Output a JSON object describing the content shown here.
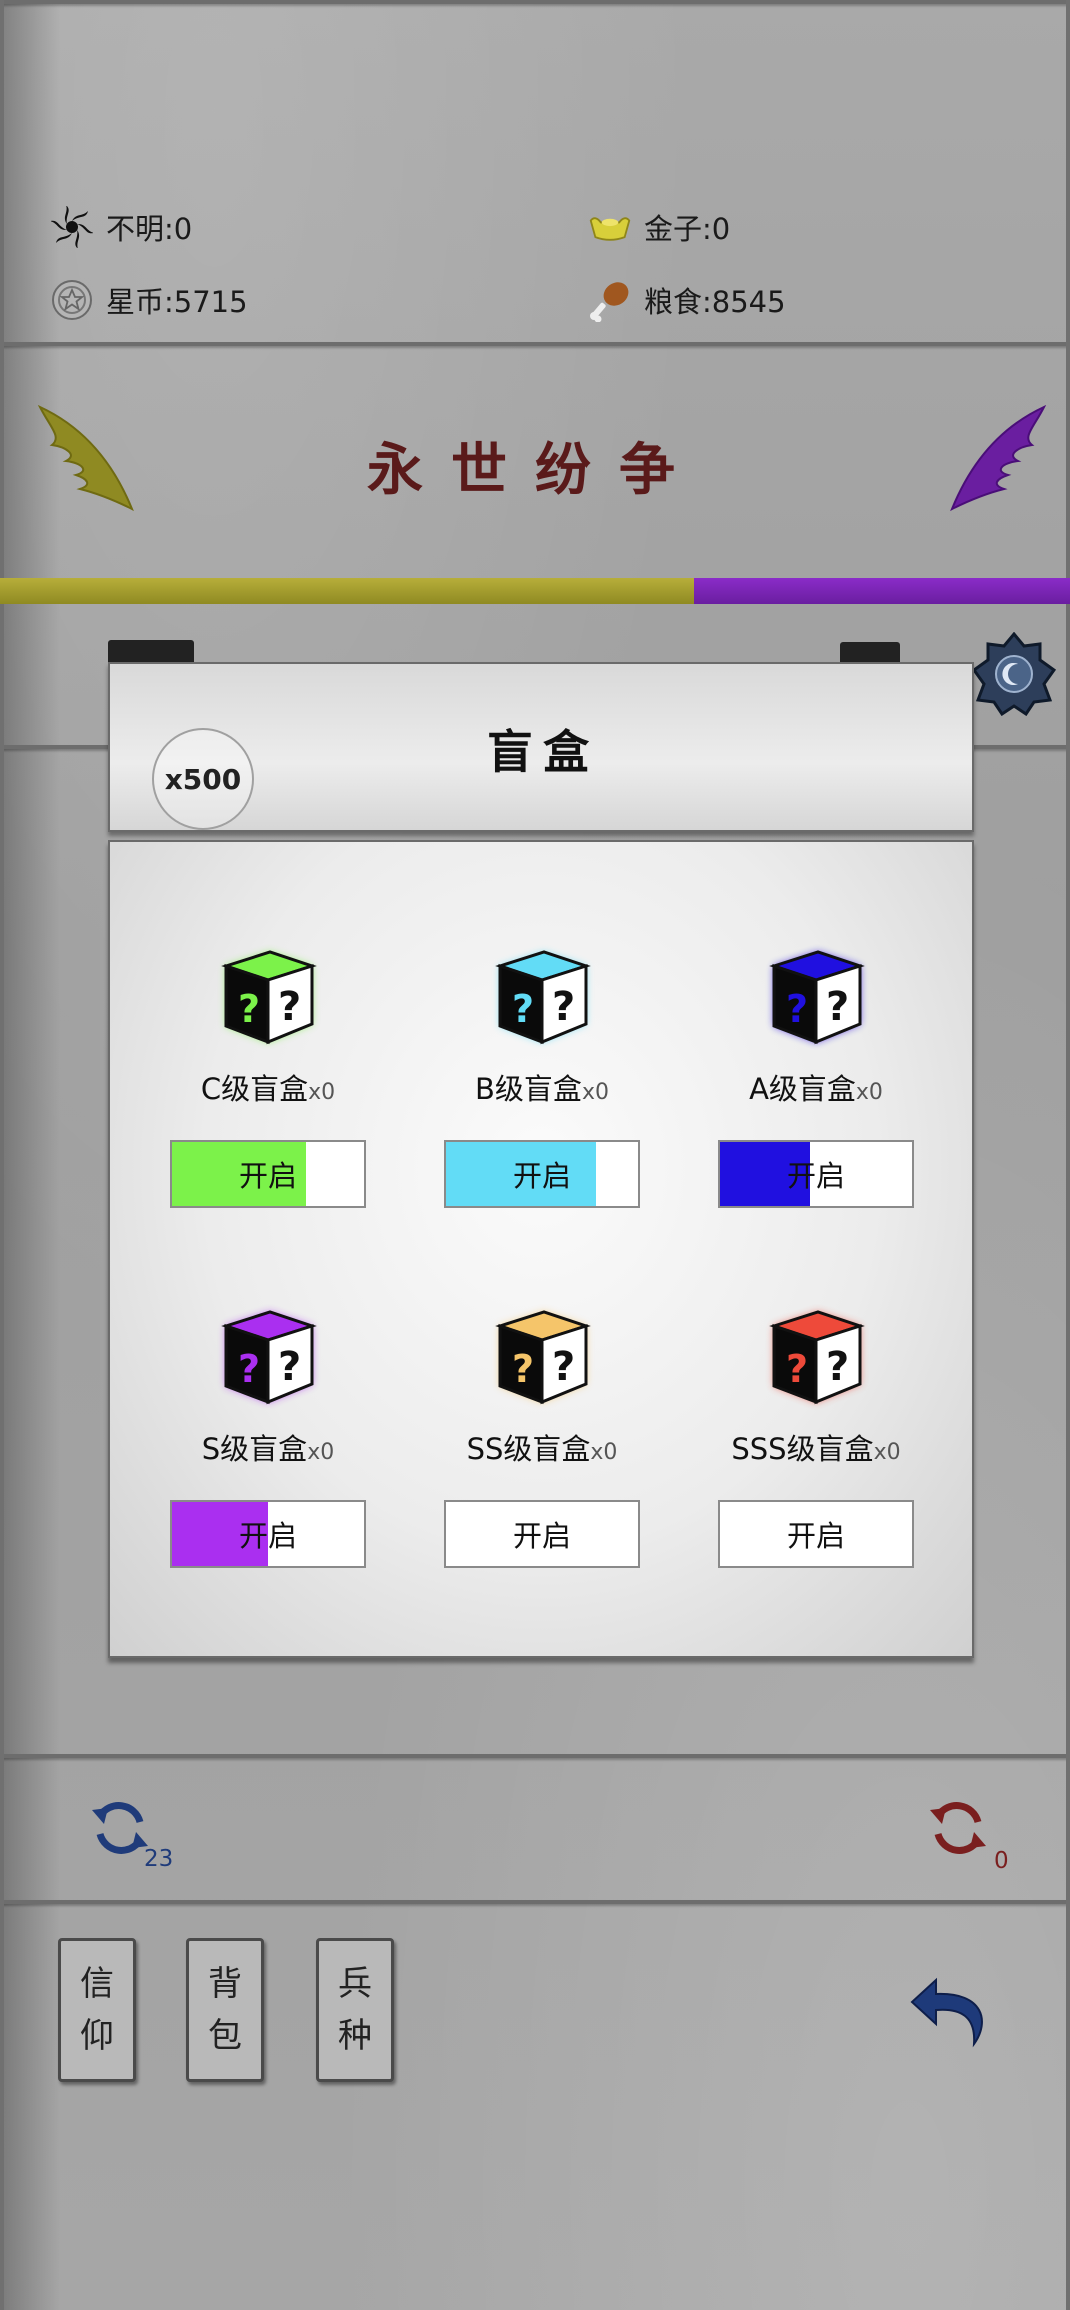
{
  "resources": [
    {
      "label": "不明:0",
      "icon": "swirl-icon"
    },
    {
      "label": "金子:0",
      "icon": "gold-ingot-icon"
    },
    {
      "label": "星币:5715",
      "icon": "star-coin-icon"
    },
    {
      "label": "粮食:8545",
      "icon": "meat-drumstick-icon"
    }
  ],
  "title": "永世纷争",
  "modal": {
    "title": "盲盒",
    "multiplier": "x500",
    "boxes": [
      {
        "name": "C级盲盒",
        "count": "x0",
        "button": "开启",
        "progress": 0.7,
        "color": "#7cf24a"
      },
      {
        "name": "B级盲盒",
        "count": "x0",
        "button": "开启",
        "progress": 0.78,
        "color": "#62dcf6"
      },
      {
        "name": "A级盲盒",
        "count": "x0",
        "button": "开启",
        "progress": 0.47,
        "color": "#2010e0"
      },
      {
        "name": "S级盲盒",
        "count": "x0",
        "button": "开启",
        "progress": 0.5,
        "color": "#aa2ff0"
      },
      {
        "name": "SS级盲盒",
        "count": "x0",
        "button": "开启",
        "progress": 0,
        "color": "#f5c56a"
      },
      {
        "name": "SSS级盲盒",
        "count": "x0",
        "button": "开启",
        "progress": 0,
        "color": "#ee4a3a"
      }
    ]
  },
  "refresh": {
    "left_count": "23",
    "right_count": "0"
  },
  "side_buttons": [
    {
      "line1": "信",
      "line2": "仰"
    },
    {
      "line1": "背",
      "line2": "包"
    },
    {
      "line1": "兵",
      "line2": "种"
    }
  ],
  "colors": {
    "faction_left": "#8f8a22",
    "faction_right": "#6a1ea0"
  }
}
